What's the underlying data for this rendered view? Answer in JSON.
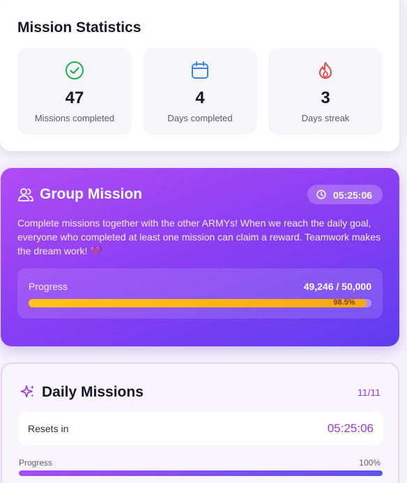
{
  "stats": {
    "title": "Mission Statistics",
    "items": [
      {
        "icon": "check-circle-icon",
        "value": "47",
        "label": "Missions completed",
        "color": "#22b04b"
      },
      {
        "icon": "calendar-icon",
        "value": "4",
        "label": "Days completed",
        "color": "#3b82f6"
      },
      {
        "icon": "flame-icon",
        "value": "3",
        "label": "Days streak",
        "color": "#ef4444"
      }
    ]
  },
  "group": {
    "icon": "group-users-icon",
    "title": "Group Mission",
    "timer_icon": "clock-icon",
    "timer": "05:25:06",
    "description": "Complete missions together with the other ARMYs! When we reach the daily goal, everyone who completed at least one mission can claim a reward. Teamwork makes the dream work!",
    "heart": "💜",
    "progress_label": "Progress",
    "progress_count": "49,246 / 50,000",
    "progress_percent": "98.5%",
    "progress_fraction": 0.985,
    "gradient_start": "#b04cf6",
    "gradient_end": "#5f3df0",
    "bar_color": "#ffc21a"
  },
  "daily": {
    "icon": "sparkles-icon",
    "title": "Daily Missions",
    "count": "11/11",
    "resets_label": "Resets in",
    "resets_time": "05:25:06",
    "progress_label": "Progress",
    "progress_percent": "100%",
    "progress_fraction": 1.0,
    "accent": "#9a38d8"
  }
}
